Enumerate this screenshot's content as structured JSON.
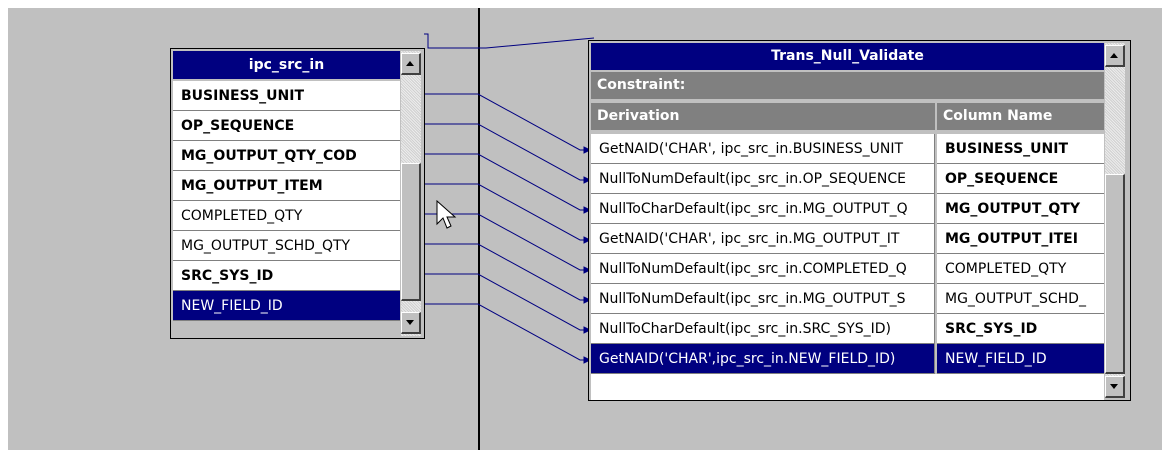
{
  "source_table": {
    "title": "ipc_src_in",
    "fields": [
      {
        "name": "BUSINESS_UNIT",
        "key": true,
        "selected": false
      },
      {
        "name": "OP_SEQUENCE",
        "key": true,
        "selected": false
      },
      {
        "name": "MG_OUTPUT_QTY_COD",
        "key": true,
        "selected": false
      },
      {
        "name": "MG_OUTPUT_ITEM",
        "key": true,
        "selected": false
      },
      {
        "name": "COMPLETED_QTY",
        "key": false,
        "selected": false
      },
      {
        "name": "MG_OUTPUT_SCHD_QTY",
        "key": false,
        "selected": false
      },
      {
        "name": "SRC_SYS_ID",
        "key": true,
        "selected": false
      },
      {
        "name": "NEW_FIELD_ID",
        "key": false,
        "selected": true
      }
    ]
  },
  "transformer": {
    "title": "Trans_Null_Validate",
    "constraint_label": "Constraint:",
    "columns": {
      "derivation": "Derivation",
      "column_name": "Column Name"
    },
    "rows": [
      {
        "derivation": "GetNAID('CHAR', ipc_src_in.BUSINESS_UNIT",
        "column": "BUSINESS_UNIT",
        "key": true,
        "selected": false
      },
      {
        "derivation": "NullToNumDefault(ipc_src_in.OP_SEQUENCE",
        "column": "OP_SEQUENCE",
        "key": true,
        "selected": false
      },
      {
        "derivation": "NullToCharDefault(ipc_src_in.MG_OUTPUT_Q",
        "column": "MG_OUTPUT_QTY",
        "key": true,
        "selected": false
      },
      {
        "derivation": "GetNAID('CHAR', ipc_src_in.MG_OUTPUT_IT",
        "column": "MG_OUTPUT_ITEI",
        "key": true,
        "selected": false
      },
      {
        "derivation": "NullToNumDefault(ipc_src_in.COMPLETED_Q",
        "column": "COMPLETED_QTY",
        "key": false,
        "selected": false
      },
      {
        "derivation": "NullToNumDefault(ipc_src_in.MG_OUTPUT_S",
        "column": "MG_OUTPUT_SCHD_",
        "key": false,
        "selected": false
      },
      {
        "derivation": "NullToCharDefault(ipc_src_in.SRC_SYS_ID)",
        "column": "SRC_SYS_ID",
        "key": true,
        "selected": false
      },
      {
        "derivation": "GetNAID('CHAR',ipc_src_in.NEW_FIELD_ID)",
        "column": "NEW_FIELD_ID",
        "key": false,
        "selected": true
      }
    ]
  },
  "colors": {
    "selection": "#000080",
    "link_line": "#000080",
    "background": "#c0c0c0"
  }
}
